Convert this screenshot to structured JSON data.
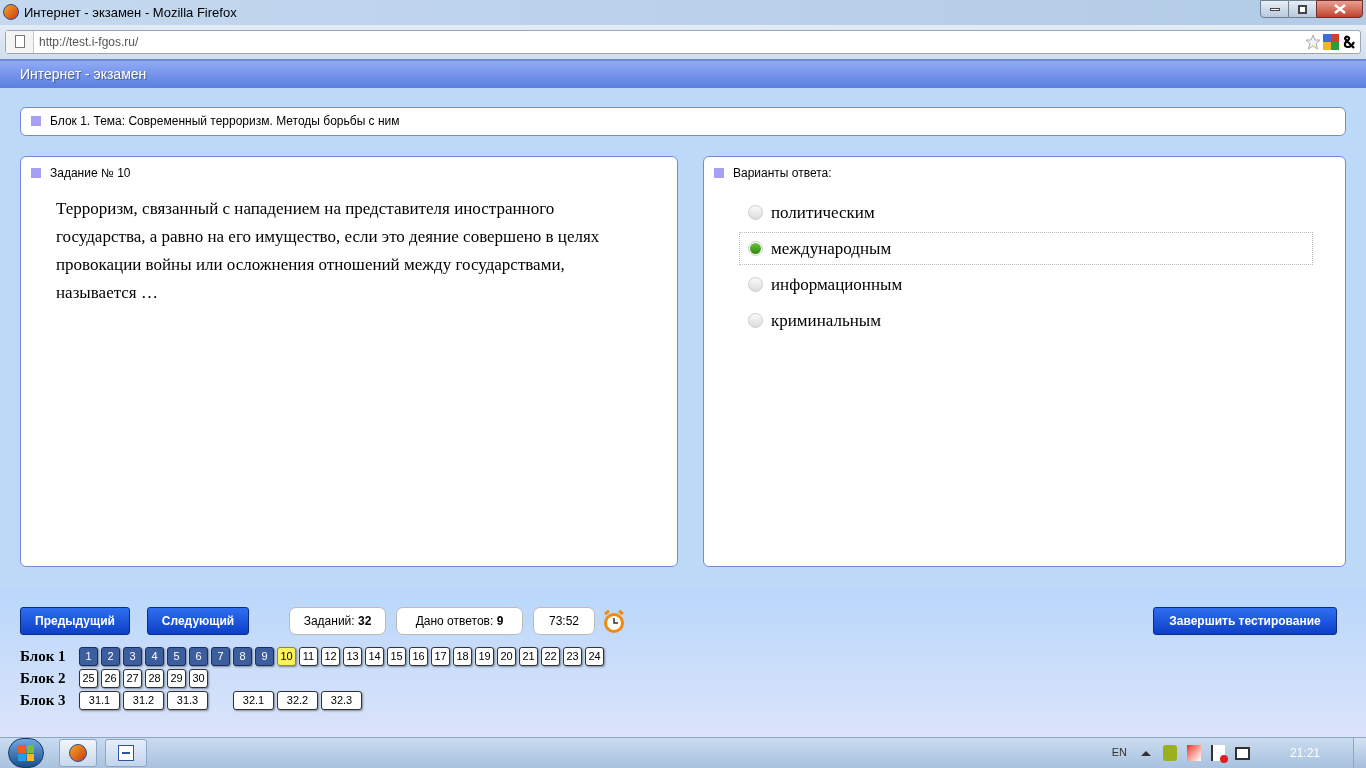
{
  "window": {
    "title": "Интернет - экзамен - Mozilla Firefox"
  },
  "address_bar": {
    "value": "http://test.i-fgos.ru/"
  },
  "app_header": {
    "title": "Интернет - экзамен"
  },
  "topic": {
    "text": "Блок 1. Тема: Современный терроризм. Методы борьбы с ним"
  },
  "question": {
    "heading": "Задание № 10",
    "text": "Терроризм, связанный с нападением на представителя иностранного государства, а равно на его имущество, если это деяние совершено в целях провокации войны или осложнения отношений между государствами, называется …"
  },
  "answers": {
    "heading": "Варианты ответа:",
    "options": [
      {
        "label": "политическим",
        "selected": false
      },
      {
        "label": "международным",
        "selected": true
      },
      {
        "label": "информационным",
        "selected": false
      },
      {
        "label": "криминальным",
        "selected": false
      }
    ]
  },
  "controls": {
    "prev": "Предыдущий",
    "next": "Следующий",
    "tasks": "Заданий: **32**",
    "answered": "Дано ответов: **9**",
    "timer": "73:52",
    "finish": "Завершить тестирование"
  },
  "blocks": [
    {
      "label": "Блок 1",
      "groups": [
        [
          {
            "n": "1",
            "answered": true,
            "selected": false
          },
          {
            "n": "2",
            "answered": true,
            "selected": false
          },
          {
            "n": "3",
            "answered": true,
            "selected": false
          },
          {
            "n": "4",
            "answered": true,
            "selected": false
          },
          {
            "n": "5",
            "answered": true,
            "selected": false
          },
          {
            "n": "6",
            "answered": true,
            "selected": false
          },
          {
            "n": "7",
            "answered": true,
            "selected": false
          },
          {
            "n": "8",
            "answered": true,
            "selected": false
          },
          {
            "n": "9",
            "answered": true,
            "selected": false
          },
          {
            "n": "10",
            "answered": false,
            "selected": true
          },
          {
            "n": "11",
            "answered": false,
            "selected": false
          },
          {
            "n": "12",
            "answered": false,
            "selected": false
          },
          {
            "n": "13",
            "answered": false,
            "selected": false
          },
          {
            "n": "14",
            "answered": false,
            "selected": false
          },
          {
            "n": "15",
            "answered": false,
            "selected": false
          },
          {
            "n": "16",
            "answered": false,
            "selected": false
          },
          {
            "n": "17",
            "answered": false,
            "selected": false
          },
          {
            "n": "18",
            "answered": false,
            "selected": false
          },
          {
            "n": "19",
            "answered": false,
            "selected": false
          },
          {
            "n": "20",
            "answered": false,
            "selected": false
          },
          {
            "n": "21",
            "answered": false,
            "selected": false
          },
          {
            "n": "22",
            "answered": false,
            "selected": false
          },
          {
            "n": "23",
            "answered": false,
            "selected": false
          },
          {
            "n": "24",
            "answered": false,
            "selected": false
          }
        ]
      ]
    },
    {
      "label": "Блок 2",
      "groups": [
        [
          {
            "n": "25",
            "answered": false,
            "selected": false
          },
          {
            "n": "26",
            "answered": false,
            "selected": false
          },
          {
            "n": "27",
            "answered": false,
            "selected": false
          },
          {
            "n": "28",
            "answered": false,
            "selected": false
          },
          {
            "n": "29",
            "answered": false,
            "selected": false
          },
          {
            "n": "30",
            "answered": false,
            "selected": false
          }
        ]
      ]
    },
    {
      "label": "Блок 3",
      "groups": [
        [
          {
            "n": "31.1",
            "answered": false,
            "selected": false
          },
          {
            "n": "31.2",
            "answered": false,
            "selected": false
          },
          {
            "n": "31.3",
            "answered": false,
            "selected": false
          }
        ],
        [
          {
            "n": "32.1",
            "answered": false,
            "selected": false
          },
          {
            "n": "32.2",
            "answered": false,
            "selected": false
          },
          {
            "n": "32.3",
            "answered": false,
            "selected": false
          }
        ]
      ]
    }
  ],
  "taskbar": {
    "language": "EN",
    "clock": "21:21"
  }
}
